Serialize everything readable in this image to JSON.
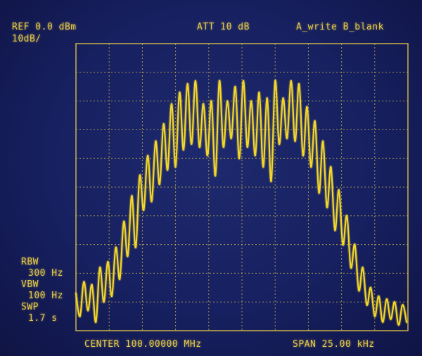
{
  "header": {
    "ref": "REF 0.0 dBm",
    "scale": "10dB/",
    "attenuation": "ATT 10 dB",
    "trace_mode": "A_write B_blank"
  },
  "settings": {
    "rbw_label": "RBW",
    "rbw_value": "300 Hz",
    "vbw_label": "VBW",
    "vbw_value": "100 Hz",
    "swp_label": "SWP",
    "swp_value": "1.7 s"
  },
  "footer": {
    "center": "CENTER 100.00000 MHz",
    "span": "SPAN 25.00 kHz"
  },
  "colors": {
    "screen_bg": "#172060",
    "trace": "#f2d62a",
    "grid": "#c9b24a",
    "text": "#e3c94a"
  },
  "chart_data": {
    "type": "line",
    "title": "",
    "xlabel": "",
    "ylabel": "",
    "x_unit": "kHz offset from center",
    "y_unit": "dB",
    "xlim": [
      -12.5,
      12.5
    ],
    "ylim": [
      -100,
      0
    ],
    "grid": true,
    "grid_divisions": {
      "x": 10,
      "y": 10
    },
    "legend": "none",
    "series": [
      {
        "x": [
          -12.5,
          -12.2,
          -11.9,
          -11.6,
          -11.3,
          -11.0,
          -10.7,
          -10.4,
          -10.1,
          -9.8,
          -9.5,
          -9.2,
          -8.9,
          -8.6,
          -8.3,
          -8.0,
          -7.7,
          -7.4,
          -7.1,
          -6.8,
          -6.5,
          -6.2,
          -5.9,
          -5.6,
          -5.3,
          -5.0,
          -4.7,
          -4.4,
          -4.1,
          -3.8,
          -3.5,
          -3.2,
          -2.9,
          -2.6,
          -2.3,
          -2.0,
          -1.7,
          -1.4,
          -1.1,
          -0.8,
          -0.5,
          -0.2,
          0.1,
          0.4,
          0.7,
          1.0,
          1.3,
          1.6,
          1.9,
          2.2,
          2.5,
          2.8,
          3.1,
          3.4,
          3.7,
          4.0,
          4.3,
          4.6,
          4.9,
          5.2,
          5.5,
          5.8,
          6.1,
          6.4,
          6.7,
          7.0,
          7.3,
          7.6,
          7.9,
          8.2,
          8.5,
          8.8,
          9.1,
          9.4,
          9.7,
          10.0,
          10.3,
          10.6,
          10.9,
          11.2,
          11.5,
          11.8,
          12.1,
          12.4
        ],
        "y": [
          -87,
          -95,
          -83,
          -93,
          -84,
          -97,
          -78,
          -90,
          -76,
          -88,
          -71,
          -82,
          -62,
          -74,
          -53,
          -71,
          -46,
          -58,
          -39,
          -55,
          -34,
          -49,
          -28,
          -44,
          -21,
          -43,
          -17,
          -37,
          -14,
          -35,
          -13,
          -36,
          -21,
          -39,
          -20,
          -46,
          -13,
          -36,
          -20,
          -33,
          -15,
          -40,
          -13,
          -36,
          -20,
          -39,
          -17,
          -43,
          -19,
          -48,
          -13,
          -35,
          -19,
          -33,
          -13,
          -34,
          -14,
          -39,
          -22,
          -43,
          -27,
          -52,
          -34,
          -57,
          -43,
          -65,
          -51,
          -70,
          -60,
          -78,
          -70,
          -86,
          -78,
          -91,
          -85,
          -95,
          -88,
          -97,
          -89,
          -96,
          -90,
          -98,
          -91,
          -97
        ]
      }
    ]
  }
}
